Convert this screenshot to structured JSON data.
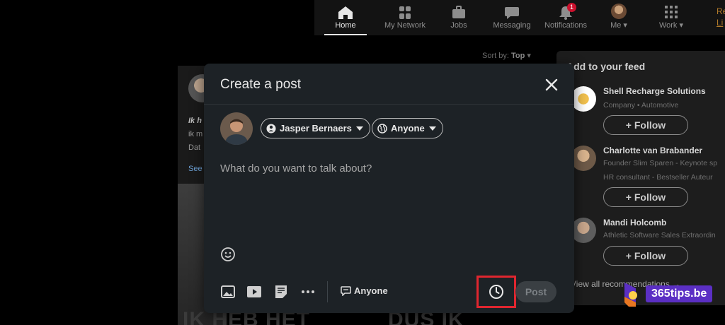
{
  "nav": {
    "items": [
      {
        "label": "Home",
        "icon": "home-icon"
      },
      {
        "label": "My Network",
        "icon": "network-icon"
      },
      {
        "label": "Jobs",
        "icon": "briefcase-icon"
      },
      {
        "label": "Messaging",
        "icon": "message-icon"
      },
      {
        "label": "Notifications",
        "icon": "bell-icon",
        "badge": "1"
      },
      {
        "label": "Me",
        "icon": "avatar"
      },
      {
        "label": "Work",
        "icon": "grid-icon"
      }
    ],
    "cut_text_top": "Re",
    "cut_text_bottom": "Li"
  },
  "feed": {
    "sort_label": "Sort by:",
    "sort_value": "Top",
    "partial_lines": [
      "Ik h",
      "ik m",
      "Dat",
      "See"
    ],
    "big_text_left": "IK HEB HET",
    "big_text_right": "DUS IK"
  },
  "suggestions": {
    "heading": "Add to your feed",
    "items": [
      {
        "name": "Shell Recharge Solutions",
        "sub1": "Company • Automotive",
        "sub2": "",
        "follow": "+ Follow"
      },
      {
        "name": "Charlotte van Brabander",
        "sub1": "Founder Slim Sparen - Keynote sp",
        "sub2": "HR consultant - Bestseller Auteur",
        "follow": "+ Follow"
      },
      {
        "name": "Mandi Holcomb",
        "sub1": "Athletic Software Sales Extraordin",
        "sub2": "",
        "follow": "+ Follow"
      }
    ],
    "view_all": "View all recommendations →"
  },
  "watermark": "365tips.be",
  "modal": {
    "title": "Create a post",
    "author": "Jasper Bernaers",
    "visibility": "Anyone",
    "placeholder": "What do you want to talk about?",
    "comment_control": "Anyone",
    "post_label": "Post"
  },
  "colors": {
    "highlight": "#e0262f",
    "modal_bg": "#1d2226",
    "watermark_bg": "#5b2fc4",
    "badge": "#cb112d"
  }
}
